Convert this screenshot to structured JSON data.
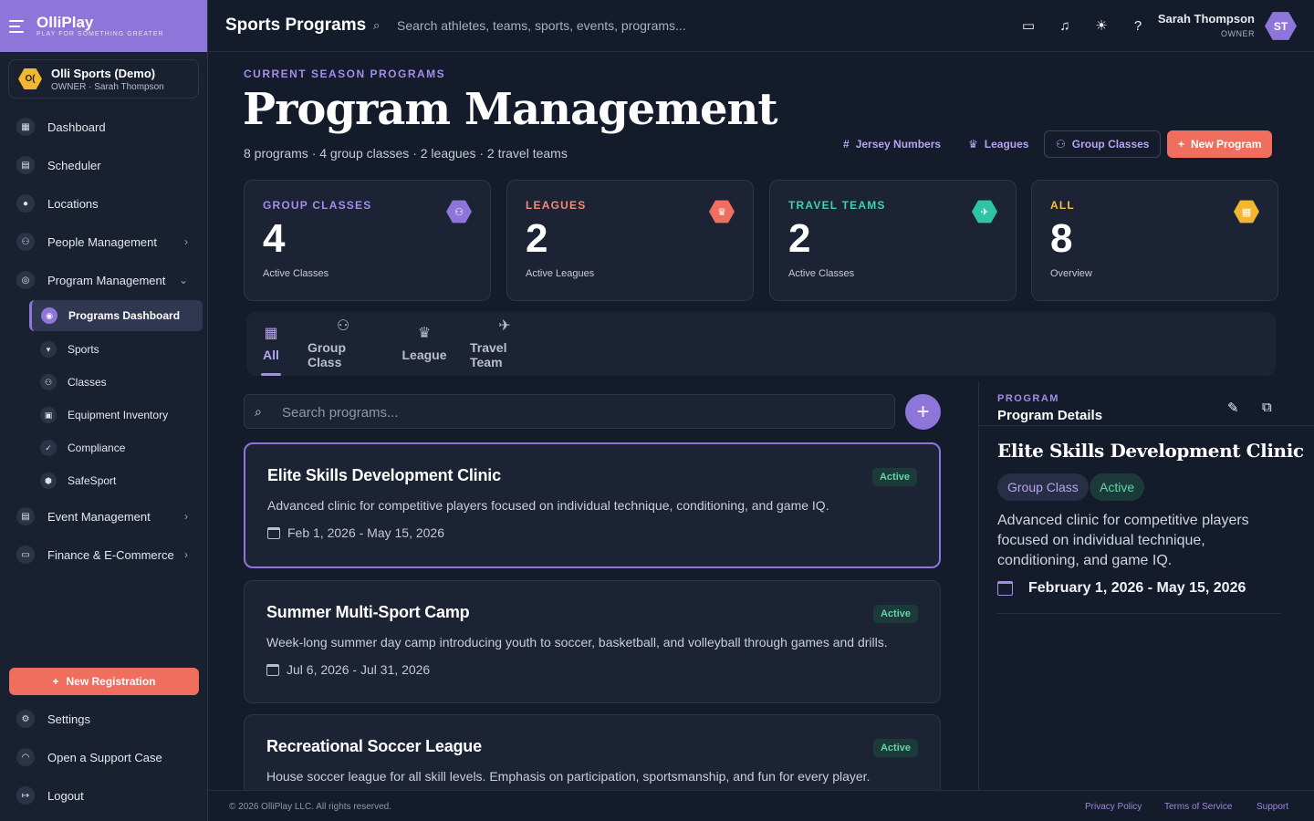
{
  "brand": {
    "name": "OlliPlay",
    "tagline": "PLAY FOR SOMETHING GREATER"
  },
  "org": {
    "initials": "O(",
    "name": "Olli Sports (Demo)",
    "sub": "OWNER · Sarah Thompson"
  },
  "sidebar": {
    "items": [
      {
        "label": "Dashboard",
        "icon": "dashboard-icon"
      },
      {
        "label": "Scheduler",
        "icon": "calendar-icon"
      },
      {
        "label": "Locations",
        "icon": "location-pin-icon"
      },
      {
        "label": "People Management",
        "icon": "people-icon"
      },
      {
        "label": "Program Management",
        "icon": "program-icon"
      }
    ],
    "sub_items": [
      {
        "label": "Programs Dashboard"
      },
      {
        "label": "Sports"
      },
      {
        "label": "Classes"
      },
      {
        "label": "Equipment Inventory"
      },
      {
        "label": "Compliance"
      },
      {
        "label": "SafeSport"
      }
    ],
    "items_after": [
      {
        "label": "Event Management"
      },
      {
        "label": "Finance & E-Commerce"
      }
    ],
    "new_registration": "New Registration",
    "bottom": [
      {
        "label": "Settings"
      },
      {
        "label": "Open a Support Case"
      },
      {
        "label": "Logout"
      }
    ]
  },
  "topbar": {
    "title": "Sports Programs",
    "search_placeholder": "Search athletes, teams, sports, events, programs...",
    "user_name": "Sarah Thompson",
    "user_role": "OWNER",
    "avatar": "ST"
  },
  "header": {
    "eyebrow": "CURRENT SEASON PROGRAMS",
    "title": "Program Management",
    "subtitle": "8 programs · 4 group classes · 2 leagues · 2 travel teams",
    "buttons": {
      "jersey": "Jersey Numbers",
      "leagues": "Leagues",
      "group_classes": "Group Classes",
      "new_program": "New Program"
    }
  },
  "stats": [
    {
      "label": "GROUP CLASSES",
      "value": "4",
      "sub": "Active Classes",
      "color": "#8d75d9"
    },
    {
      "label": "LEAGUES",
      "value": "2",
      "sub": "Active Leagues",
      "color": "#f06e5e"
    },
    {
      "label": "TRAVEL TEAMS",
      "value": "2",
      "sub": "Active Classes",
      "color": "#2ec4a6"
    },
    {
      "label": "ALL",
      "value": "8",
      "sub": "Overview",
      "color": "#f3b62f"
    }
  ],
  "tabs": [
    {
      "label": "All"
    },
    {
      "label": "Group Class"
    },
    {
      "label": "League"
    },
    {
      "label": "Travel Team"
    }
  ],
  "search": {
    "placeholder": "Search programs..."
  },
  "programs": [
    {
      "title": "Elite Skills Development Clinic",
      "desc": "Advanced clinic for competitive players focused on individual technique, conditioning, and game IQ.",
      "date": "Feb 1, 2026 - May 15, 2026",
      "status": "Active"
    },
    {
      "title": "Summer Multi-Sport Camp",
      "desc": "Week-long summer day camp introducing youth to soccer, basketball, and volleyball through games and drills.",
      "date": "Jul 6, 2026 - Jul 31, 2026",
      "status": "Active"
    },
    {
      "title": "Recreational Soccer League",
      "desc": "House soccer league for all skill levels. Emphasis on participation, sportsmanship, and fun for every player.",
      "date": "",
      "status": "Active"
    }
  ],
  "detail": {
    "eyebrow": "PROGRAM",
    "heading": "Program Details",
    "title": "Elite Skills Development Clinic",
    "type": "Group Class",
    "status": "Active",
    "desc": "Advanced clinic for competitive players focused on individual technique, conditioning, and game IQ.",
    "date": "February 1, 2026 - May 15, 2026"
  },
  "footer": {
    "copyright": "© 2026 OlliPlay LLC. All rights reserved.",
    "links": [
      "Privacy Policy",
      "Terms of Service",
      "Support"
    ]
  }
}
